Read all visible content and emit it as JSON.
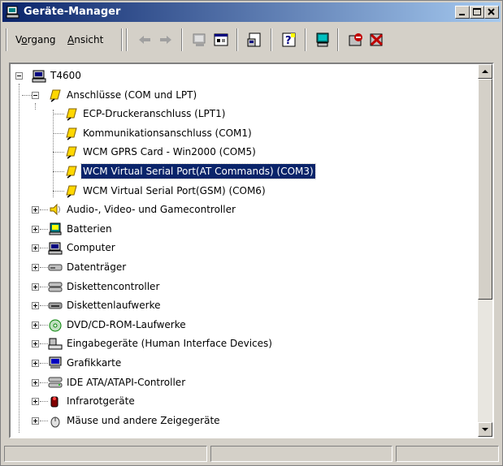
{
  "window": {
    "title": "Geräte-Manager"
  },
  "menu": {
    "vorgang": "Vorgang",
    "ansicht": "Ansicht"
  },
  "toolbar": {
    "icons": [
      "back-arrow-icon",
      "forward-arrow-icon",
      "computer-view-icon",
      "list-view-icon",
      "properties-icon",
      "help-icon",
      "scan-hardware-icon",
      "uninstall-icon",
      "disable-device-icon"
    ]
  },
  "tree": {
    "root": "T4600",
    "ports_group": "Anschlüsse (COM und LPT)",
    "ports": [
      "ECP-Druckeranschluss (LPT1)",
      "Kommunikationsanschluss (COM1)",
      "WCM GPRS Card - Win2000 (COM5)",
      "WCM Virtual Serial Port(AT Commands) (COM3)",
      "WCM Virtual Serial Port(GSM) (COM6)"
    ],
    "selected_port_index": 3,
    "categories": [
      "Audio-, Video- und Gamecontroller",
      "Batterien",
      "Computer",
      "Datenträger",
      "Diskettencontroller",
      "Diskettenlaufwerke",
      "DVD/CD-ROM-Laufwerke",
      "Eingabegeräte (Human Interface Devices)",
      "Grafikkarte",
      "IDE ATA/ATAPI-Controller",
      "Infrarotgeräte",
      "Mäuse und andere Zeigegeräte"
    ]
  },
  "colors": {
    "title_start": "#0a246a",
    "title_end": "#a6caf0",
    "selection": "#0a246a",
    "face": "#d4d0c8"
  }
}
